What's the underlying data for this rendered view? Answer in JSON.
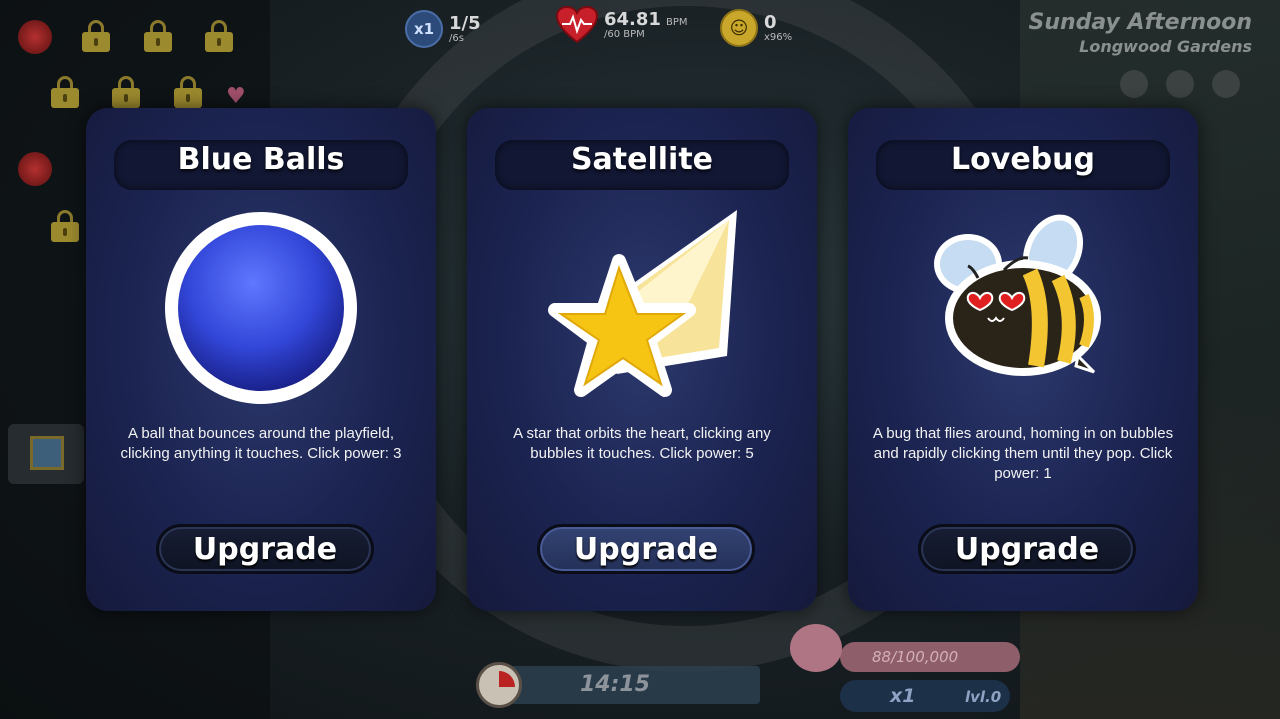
{
  "hud": {
    "combo_multiplier": "x1",
    "combo_count": "1/5",
    "combo_time": "/6s",
    "bpm_value": "64.81",
    "bpm_unit": "BPM",
    "bpm_target": "/60 BPM",
    "smile_count": "0",
    "smile_multiplier": "x96%"
  },
  "location": {
    "time_of_day": "Sunday Afternoon",
    "place": "Longwood Gardens"
  },
  "cards": [
    {
      "title": "Blue Balls",
      "description": "A ball that bounces around the playfield, clicking anything it touches. Click power: 3",
      "button": "Upgrade",
      "icon": "blue-ball-icon"
    },
    {
      "title": "Satellite",
      "description": "A star that orbits the heart, clicking any bubbles it touches. Click power: 5",
      "button": "Upgrade",
      "icon": "shooting-star-icon"
    },
    {
      "title": "Lovebug",
      "description": "A bug that flies around, homing in on bubbles and rapidly clicking them until they pop. Click power: 1",
      "button": "Upgrade",
      "icon": "bee-icon"
    }
  ],
  "bottom": {
    "timer": "14:15",
    "xp_progress": "88/100,000",
    "xp_multiplier": "x1",
    "level": "lvl.0"
  },
  "colors": {
    "card_bg": "#1b2350",
    "button_bg": "#171d33",
    "button_hover_bg": "#334373"
  }
}
